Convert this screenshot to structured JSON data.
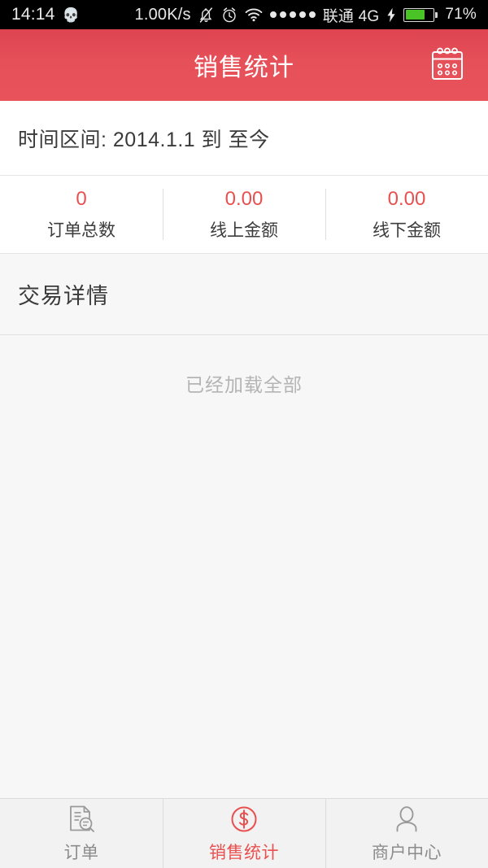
{
  "statusbar": {
    "time": "14:14",
    "emoji": "💀",
    "network_speed": "1.00K/s",
    "icons": [
      "bell-muted-icon",
      "alarm-clock-icon",
      "wifi-icon",
      "signal-dots-icon"
    ],
    "signal_dots": 5,
    "carrier": "联通 4G",
    "charging": true,
    "battery_percent": "71%",
    "battery_level": 71
  },
  "header": {
    "title": "销售统计",
    "calendar_icon": "calendar-icon",
    "background_color": "#e6505a"
  },
  "date_range": {
    "text": "时间区间: 2014.1.1 到 至今",
    "label": "时间区间:",
    "start": "2014.1.1",
    "separator": "到",
    "end": "至今"
  },
  "stats": {
    "accent_color": "#e8504f",
    "items": [
      {
        "value": "0",
        "label": "订单总数"
      },
      {
        "value": "0.00",
        "label": "线上金额"
      },
      {
        "value": "0.00",
        "label": "线下金额"
      }
    ]
  },
  "section": {
    "title": "交易详情"
  },
  "list": {
    "empty_hint": "已经加载全部",
    "rows": []
  },
  "tabbar": {
    "active_color": "#e8504f",
    "inactive_color": "#8c8c8c",
    "tabs": [
      {
        "label": "订单",
        "icon": "document-search-icon",
        "active": false
      },
      {
        "label": "销售统计",
        "icon": "dollar-circle-icon",
        "active": true
      },
      {
        "label": "商户中心",
        "icon": "person-icon",
        "active": false
      }
    ]
  }
}
